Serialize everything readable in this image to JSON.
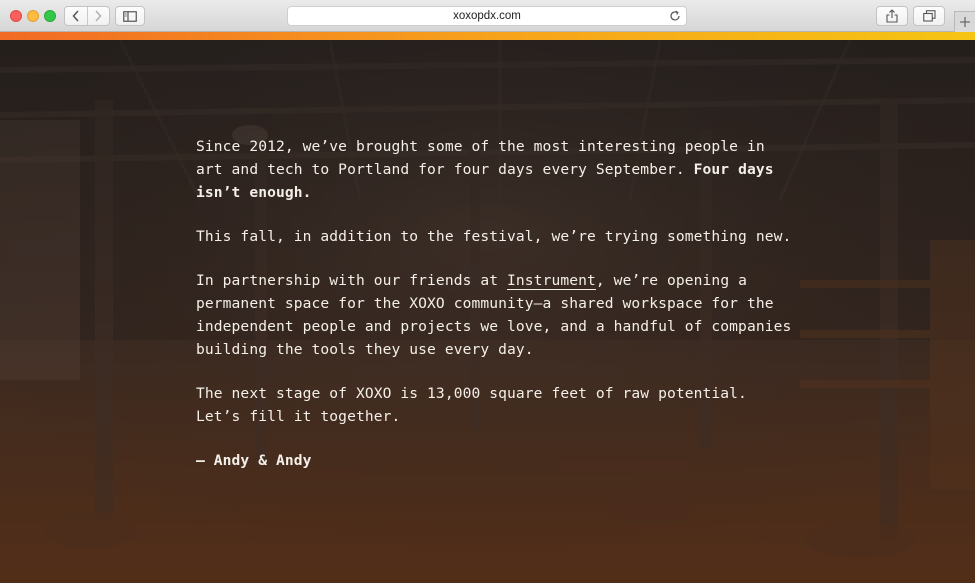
{
  "browser": {
    "url": "xoxopdx.com",
    "accent_gradient": [
      "#f26a25",
      "#f7a21b",
      "#f6c514"
    ]
  },
  "letter": {
    "p1_text": "Since 2012, we’ve brought some of the most interesting people in art and tech to Portland for four days every September. ",
    "p1_bold": "Four days isn’t enough.",
    "p2": "This fall, in addition to the festival, we’re trying something new.",
    "p3_before": "In partnership with our friends at ",
    "p3_link": "Instrument",
    "p3_after": ", we’re opening a permanent space for the XOXO community—a shared workspace for the independent people and projects we love, and a handful of companies building the tools they use every day.",
    "p4_line1": "The next stage of XOXO is 13,000 square feet of raw potential.",
    "p4_line2": "Let’s fill it together.",
    "signature": "— Andy & Andy"
  },
  "icons": {
    "back": "chevron-left-icon",
    "forward": "chevron-right-icon",
    "sidebar": "sidebar-icon",
    "reload": "reload-icon",
    "share": "share-icon",
    "tabs": "tabs-icon",
    "new_tab": "plus-icon"
  }
}
